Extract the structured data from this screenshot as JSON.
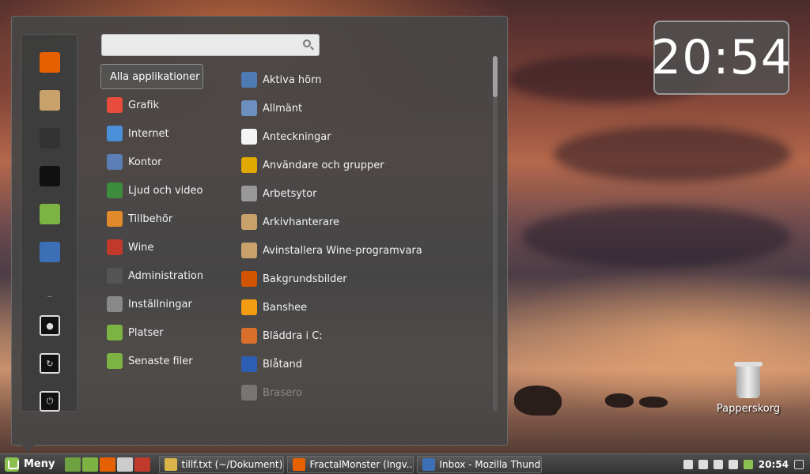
{
  "desktop": {
    "clock": "20:54",
    "trash_label": "Papperskorg"
  },
  "menu": {
    "search": {
      "value": "",
      "placeholder": ""
    },
    "favorites": [
      {
        "name": "firefox-icon",
        "color": "#e66000"
      },
      {
        "name": "archive-manager-icon",
        "color": "#c9a26b"
      },
      {
        "name": "system-settings-icon",
        "color": "#333333"
      },
      {
        "name": "terminal-icon",
        "color": "#111111"
      },
      {
        "name": "folder-icon",
        "color": "#7cb342"
      },
      {
        "name": "thunderbird-icon",
        "color": "#3d6fb6"
      }
    ],
    "system_buttons": [
      {
        "name": "lock-icon"
      },
      {
        "name": "logout-icon"
      },
      {
        "name": "power-icon"
      }
    ],
    "all_apps_label": "Alla applikationer",
    "categories": [
      {
        "label": "Grafik",
        "icon": "graphics-icon",
        "color": "#e74c3c"
      },
      {
        "label": "Internet",
        "icon": "internet-icon",
        "color": "#4a90d9"
      },
      {
        "label": "Kontor",
        "icon": "office-icon",
        "color": "#5b7fb5"
      },
      {
        "label": "Ljud och video",
        "icon": "media-icon",
        "color": "#3c8c3c"
      },
      {
        "label": "Tillbehör",
        "icon": "accessories-icon",
        "color": "#e08a2c"
      },
      {
        "label": "Wine",
        "icon": "wine-icon",
        "color": "#c0392b"
      },
      {
        "label": "Administration",
        "icon": "administration-icon",
        "color": "#555555"
      },
      {
        "label": "Inställningar",
        "icon": "settings-icon",
        "color": "#888888"
      },
      {
        "label": "Platser",
        "icon": "places-icon",
        "color": "#7cb342"
      },
      {
        "label": "Senaste filer",
        "icon": "recent-files-icon",
        "color": "#7cb342"
      }
    ],
    "apps": [
      {
        "label": "Aktiva hörn",
        "icon": "hot-corners-icon",
        "color": "#4f7bb5",
        "dim": false
      },
      {
        "label": "Allmänt",
        "icon": "general-icon",
        "color": "#6d8fbf",
        "dim": false
      },
      {
        "label": "Anteckningar",
        "icon": "notes-icon",
        "color": "#f4f4f4",
        "dim": false
      },
      {
        "label": "Användare och grupper",
        "icon": "users-icon",
        "color": "#e0a800",
        "dim": false
      },
      {
        "label": "Arbetsytor",
        "icon": "workspaces-icon",
        "color": "#999999",
        "dim": false
      },
      {
        "label": "Arkivhanterare",
        "icon": "archive-icon",
        "color": "#c9a26b",
        "dim": false
      },
      {
        "label": "Avinstallera Wine-programvara",
        "icon": "uninstall-wine-icon",
        "color": "#c9a26b",
        "dim": false
      },
      {
        "label": "Bakgrundsbilder",
        "icon": "backgrounds-icon",
        "color": "#d35400",
        "dim": false
      },
      {
        "label": "Banshee",
        "icon": "banshee-icon",
        "color": "#f39c12",
        "dim": false
      },
      {
        "label": "Bläddra i C:",
        "icon": "browse-c-icon",
        "color": "#d96f2a",
        "dim": false
      },
      {
        "label": "Blåtand",
        "icon": "bluetooth-icon",
        "color": "#2c5fb3",
        "dim": false
      },
      {
        "label": "Brasero",
        "icon": "brasero-icon",
        "color": "#aaaaaa",
        "dim": true
      }
    ]
  },
  "taskbar": {
    "menu_label": "Meny",
    "launchers": [
      {
        "name": "show-desktop-icon",
        "color": "#6ea13f"
      },
      {
        "name": "files-icon",
        "color": "#7cb342"
      },
      {
        "name": "firefox-icon",
        "color": "#e66000"
      },
      {
        "name": "calculator-icon",
        "color": "#cccccc"
      },
      {
        "name": "wine-icon",
        "color": "#c0392b"
      }
    ],
    "windows": [
      {
        "label": "tillf.txt (~/Dokument) ...",
        "icon": "text-editor-icon",
        "color": "#d9b44a"
      },
      {
        "label": "FractalMonster (Ingv...",
        "icon": "firefox-icon",
        "color": "#e66000"
      },
      {
        "label": "Inbox - Mozilla Thund...",
        "icon": "thunderbird-icon",
        "color": "#3d6fb6"
      }
    ],
    "time": "20:54"
  }
}
